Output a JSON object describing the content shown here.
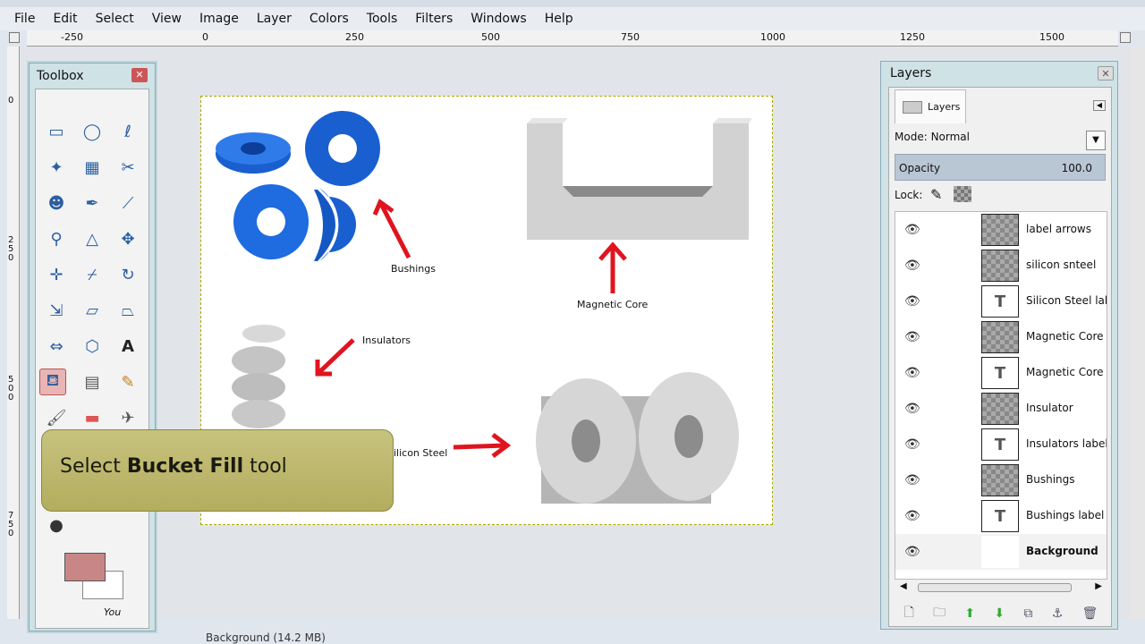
{
  "menubar": {
    "items": [
      "File",
      "Edit",
      "Select",
      "View",
      "Image",
      "Layer",
      "Colors",
      "Tools",
      "Filters",
      "Windows",
      "Help"
    ]
  },
  "ruler": {
    "top_labels": [
      "-250",
      "0",
      "250",
      "500",
      "750",
      "1000",
      "1250",
      "1500"
    ],
    "left_labels": [
      "0",
      "250",
      "500",
      "750"
    ]
  },
  "canvas": {
    "labels": {
      "bushings": "Bushings",
      "magnetic_core": "Magnetic Core",
      "insulators": "Insulators",
      "silicon_steel": "Silicon Steel"
    },
    "colors": {
      "bushing_blue": "#1a5fd0",
      "arrow_red": "#e0141e",
      "core_gray": "#c8c8c8"
    }
  },
  "toolbox": {
    "title": "Toolbox",
    "tools": [
      "rect-select-icon",
      "ellipse-select-icon",
      "free-select-icon",
      "fuzzy-select-icon",
      "color-select-icon",
      "scissors-icon",
      "foreground-select-icon",
      "paths-icon",
      "color-picker-icon",
      "zoom-icon",
      "measure-icon",
      "move-icon",
      "align-icon",
      "crop-icon",
      "rotate-icon",
      "scale-icon",
      "shear-icon",
      "perspective-icon",
      "flip-icon",
      "cage-icon",
      "text-icon",
      "bucket-fill-icon",
      "blend-icon",
      "pencil-icon",
      "paintbrush-icon",
      "eraser-icon",
      "airbrush-icon"
    ],
    "fg_color": "#c98686",
    "bg_color": "#ffffff",
    "you_label": "You"
  },
  "callout": {
    "prefix": "Select ",
    "bold": "Bucket Fill",
    "suffix": " tool"
  },
  "layers_panel": {
    "title": "Layers",
    "tab_label": "Layers",
    "mode_label": "Mode:",
    "mode_value": "Normal",
    "opacity_label": "Opacity",
    "opacity_value": "100.0",
    "lock_label": "Lock:",
    "layers": [
      {
        "name": "label arrows",
        "thumb": "checker"
      },
      {
        "name": "silicon snteel",
        "thumb": "checker"
      },
      {
        "name": "Silicon Steel label",
        "thumb": "text"
      },
      {
        "name": "Magnetic Core",
        "thumb": "checker"
      },
      {
        "name": "Magnetic Core la",
        "thumb": "text"
      },
      {
        "name": "Insulator",
        "thumb": "checker"
      },
      {
        "name": "Insulators label",
        "thumb": "text"
      },
      {
        "name": "Bushings",
        "thumb": "checker"
      },
      {
        "name": "Bushings label",
        "thumb": "text"
      },
      {
        "name": "Background",
        "thumb": "blank"
      }
    ]
  },
  "status": {
    "text": "Background (14.2 MB)"
  }
}
